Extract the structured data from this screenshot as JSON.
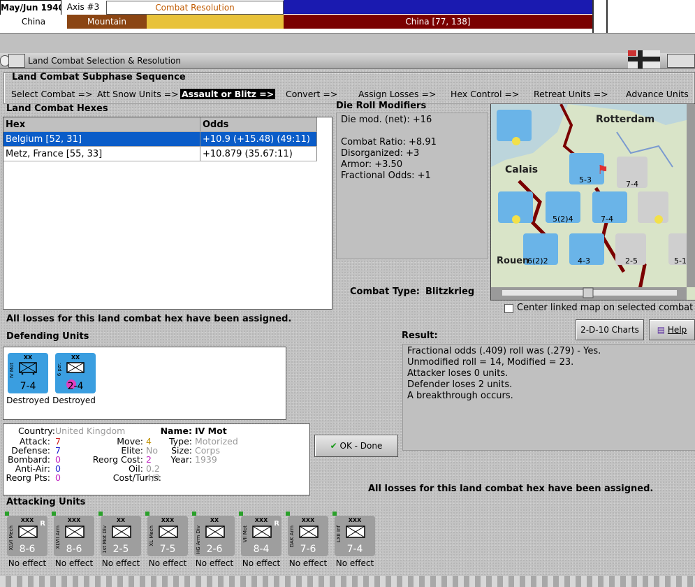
{
  "top": {
    "date": "May/Jun 1940",
    "side": "Axis #3",
    "phase": "Combat Resolution",
    "location": "China",
    "terrain": "Mountain",
    "hex_label": "China [77, 138]",
    "colors": {
      "axis_blue": "#1a1ab0",
      "red": "#7a0000",
      "yellow": "#e8c23a",
      "terrain": "#8b4513"
    }
  },
  "dialog": {
    "title": "Land Combat Selection & Resolution",
    "sequence_title": "Land Combat Subphase Sequence",
    "sequence": [
      "Select Combat =>",
      "Att Snow Units =>",
      "Assault or Blitz =>",
      "Convert =>",
      "Assign Losses =>",
      "Hex Control =>",
      "Retreat Units =>",
      "Advance Units"
    ],
    "active_step": "Assault or Blitz =>"
  },
  "hexes": {
    "title": "Land Combat Hexes",
    "columns": [
      "Hex",
      "Odds"
    ],
    "rows": [
      {
        "hex": "Belgium [52, 31]",
        "odds": "+10.9 (+15.48) (49:11)",
        "selected": true
      },
      {
        "hex": "Metz, France [55, 33]",
        "odds": "+10.879 (35.67:11)",
        "selected": false
      }
    ]
  },
  "modifiers": {
    "title": "Die Roll Modifiers",
    "lines": [
      "Die mod. (net): +16",
      "",
      "Combat Ratio: +8.91",
      "Disorganized: +3",
      "Armor: +3.50",
      "Fractional Odds: +1"
    ]
  },
  "map": {
    "labels": [
      "Rotterdam",
      "Calais",
      "Rouen"
    ],
    "units": [
      "5-3",
      "7-4",
      "5(2)4",
      "7-4",
      "6(2)2",
      "4-3",
      "2-5",
      "5-1"
    ]
  },
  "combat_type_label": "Combat Type:",
  "combat_type": "Blitzkrieg",
  "center_linked": "Center linked map on selected combat",
  "charts_button": "2-D-10 Charts",
  "help_button": "Help",
  "losses_msg": "All losses for this land combat hex have been assigned.",
  "defending": {
    "title": "Defending Units",
    "units": [
      {
        "name": "IV Mot",
        "size": "XX",
        "strength": "7-4",
        "status": "Destroyed"
      },
      {
        "name": "6 pzr.",
        "size": "XX",
        "strength": "2-4",
        "status": "Destroyed"
      }
    ]
  },
  "result": {
    "title": "Result:",
    "lines": [
      "Fractional odds (.409) roll was (.279)  - Yes.",
      "Unmodified roll = 14, Modified = 23.",
      "Attacker loses 0 units.",
      "Defender loses 2 units.",
      "A breakthrough occurs."
    ]
  },
  "details": {
    "country_label": "Country:",
    "country": "United Kingdom",
    "attack_label": "Attack:",
    "attack": "7",
    "defense_label": "Defense:",
    "defense": "7",
    "bombard_label": "Bombard:",
    "bombard": "0",
    "antiair_label": "Anti-Air:",
    "antiair": "0",
    "reorg_pts_label": "Reorg Pts:",
    "reorg_pts": "0",
    "move_label": "Move:",
    "move": "4",
    "elite_label": "Elite:",
    "elite": "No",
    "reorg_cost_label": "Reorg Cost:",
    "reorg_cost": "2",
    "oil_label": "Oil:",
    "oil": "0.2",
    "cost_label": "Cost/Turns:",
    "cost": "4/3",
    "name_label": "Name:",
    "name": "IV Mot",
    "type_label": "Type:",
    "type": "Motorized",
    "size_label": "Size:",
    "size": "Corps",
    "year_label": "Year:",
    "year": "1939"
  },
  "ok_button": "OK - Done",
  "attacking": {
    "title": "Attacking Units",
    "units": [
      {
        "name": "XLVI Mech",
        "size": "XXX",
        "strength": "8-6",
        "status": "No effect",
        "reserve": "R"
      },
      {
        "name": "XLVII Arm",
        "size": "XXX",
        "strength": "8-6",
        "status": "No effect",
        "reserve": ""
      },
      {
        "name": "1st Mot Div",
        "size": "XX",
        "strength": "2-5",
        "status": "No effect",
        "reserve": ""
      },
      {
        "name": "XL Mech",
        "size": "XXX",
        "strength": "7-5",
        "status": "No effect",
        "reserve": ""
      },
      {
        "name": "HG Arm Div",
        "size": "XX",
        "strength": "2-6",
        "status": "No effect",
        "reserve": ""
      },
      {
        "name": "VII Mot",
        "size": "XXX",
        "strength": "8-4",
        "status": "No effect",
        "reserve": "R"
      },
      {
        "name": "DAK Arm",
        "size": "XXX",
        "strength": "7-6",
        "status": "No effect",
        "reserve": ""
      },
      {
        "name": "LXII Inf",
        "size": "XXX",
        "strength": "7-4",
        "status": "No effect",
        "reserve": ""
      }
    ]
  }
}
